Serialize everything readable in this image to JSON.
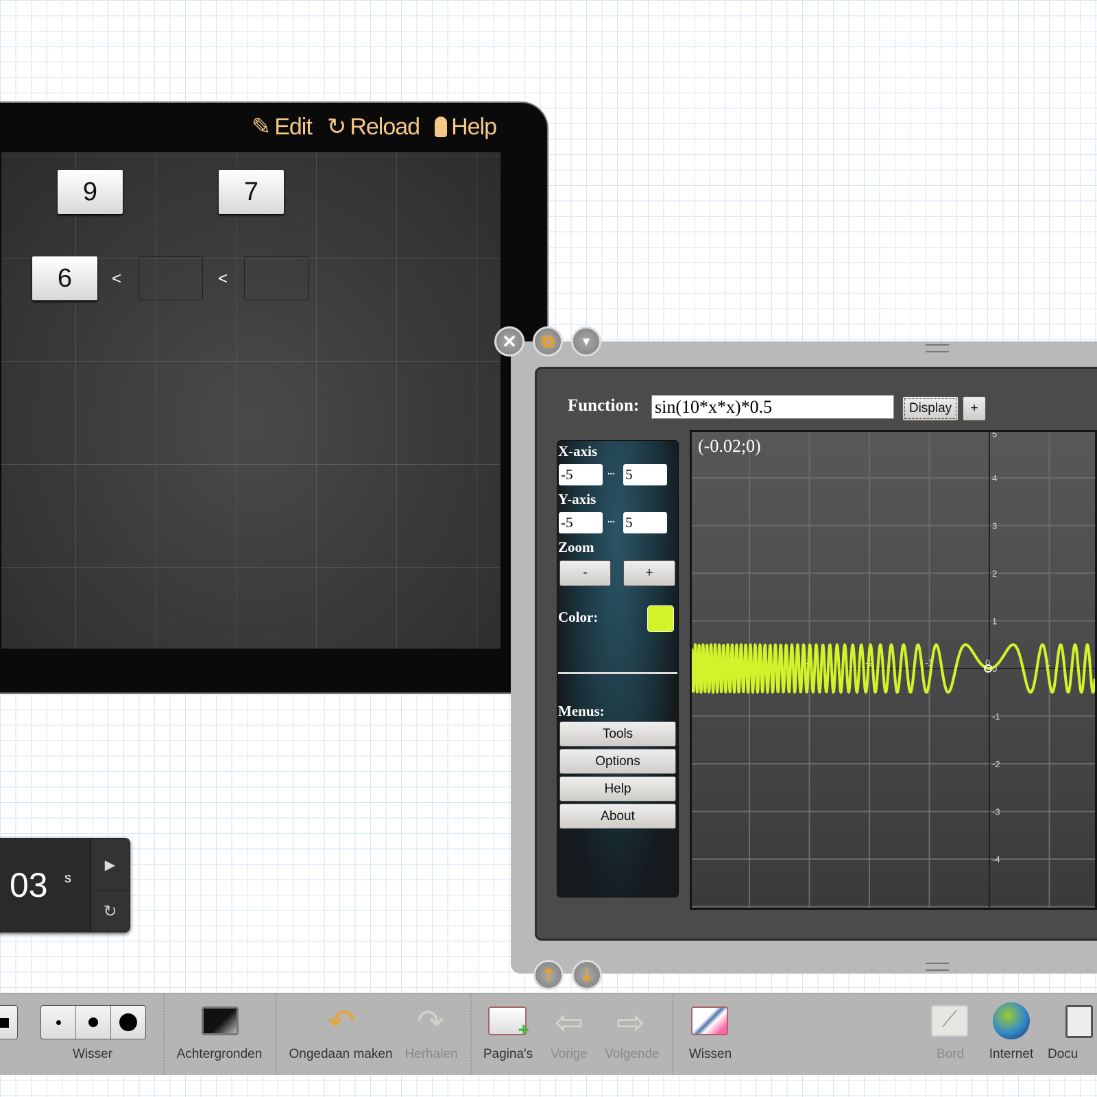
{
  "left_panel": {
    "header": {
      "edit": "Edit",
      "reload": "Reload",
      "help": "Help"
    },
    "cards_top": [
      "9",
      "7"
    ],
    "card_first": "6",
    "comparators": [
      "<",
      "<"
    ]
  },
  "timer": {
    "value": "03",
    "unit": "s"
  },
  "graph_app": {
    "function_label": "Function:",
    "function_value": "sin(10*x*x)*0.5",
    "display_button": "Display",
    "add_button": "+",
    "x_axis_label": "X-axis",
    "x_min": "-5",
    "x_max": "5",
    "y_axis_label": "Y-axis",
    "y_min": "-5",
    "y_max": "5",
    "range_sep": "...",
    "zoom_label": "Zoom",
    "zoom_out": "-",
    "zoom_in": "+",
    "color_label": "Color:",
    "color": "#d4f22a",
    "menus_label": "Menus:",
    "menus": [
      "Tools",
      "Options",
      "Help",
      "About"
    ],
    "coordinate_readout": "(-0.02;0)"
  },
  "chart_data": {
    "type": "line",
    "function": "sin(10*x*x)*0.5",
    "xlim": [
      -5,
      5
    ],
    "ylim": [
      -5,
      5
    ],
    "grid": true,
    "x_ticks": [
      "-5",
      "-4",
      "-3",
      "-2",
      "-1",
      "0",
      "1"
    ],
    "y_ticks": [
      "5",
      "4",
      "3",
      "2",
      "1",
      "0",
      "-1",
      "-2",
      "-3",
      "-4"
    ],
    "color": "#d4f22a"
  },
  "toolbar": {
    "items": [
      {
        "label": "Wisser",
        "enabled": true
      },
      {
        "label": "Achtergronden",
        "enabled": true
      },
      {
        "label": "Ongedaan maken",
        "enabled": true
      },
      {
        "label": "Herhalen",
        "enabled": false
      },
      {
        "label": "Pagina's",
        "enabled": true
      },
      {
        "label": "Vorige",
        "enabled": false
      },
      {
        "label": "Volgende",
        "enabled": false
      },
      {
        "label": "Wissen",
        "enabled": true
      },
      {
        "label": "Bord",
        "enabled": false
      },
      {
        "label": "Internet",
        "enabled": true
      },
      {
        "label": "Docu",
        "enabled": true
      }
    ]
  }
}
